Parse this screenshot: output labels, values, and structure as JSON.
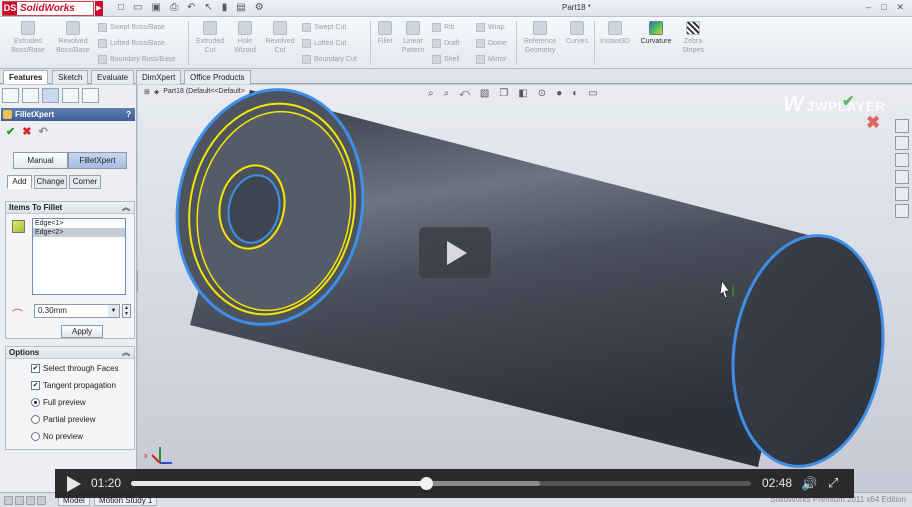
{
  "titlebar": {
    "app_name": "SolidWorks",
    "logo_letters": "DS",
    "document_title": "Part18 *",
    "window_controls": [
      "–",
      "□",
      "✕"
    ]
  },
  "ribbon": {
    "big_buttons": [
      {
        "icon": "extruded-boss-icon",
        "label1": "Extruded",
        "label2": "Boss/Base"
      },
      {
        "icon": "revolved-boss-icon",
        "label1": "Revolved",
        "label2": "Boss/Base"
      },
      {
        "icon": "extruded-cut-icon",
        "label1": "Extruded",
        "label2": "Cut"
      },
      {
        "icon": "hole-wizard-icon",
        "label1": "Hole",
        "label2": "Wizard"
      },
      {
        "icon": "revolved-cut-icon",
        "label1": "Revolved",
        "label2": "Cut"
      },
      {
        "icon": "fillet-icon",
        "label1": "Fillet",
        "label2": ""
      },
      {
        "icon": "linear-pattern-icon",
        "label1": "Linear",
        "label2": "Pattern"
      },
      {
        "icon": "reference-geometry-icon",
        "label1": "Reference",
        "label2": "Geometry"
      },
      {
        "icon": "curves-icon",
        "label1": "Curves",
        "label2": ""
      },
      {
        "icon": "instant3d-icon",
        "label1": "Instant3D",
        "label2": ""
      },
      {
        "icon": "curvature-icon",
        "label1": "Curvature",
        "label2": ""
      },
      {
        "icon": "zebra-stripes-icon",
        "label1": "Zebra",
        "label2": "Stripes"
      }
    ],
    "small_buttons": [
      {
        "icon": "swept-boss-icon",
        "label": "Swept Boss/Base"
      },
      {
        "icon": "lofted-boss-icon",
        "label": "Lofted Boss/Base"
      },
      {
        "icon": "boundary-boss-icon",
        "label": "Boundary Boss/Base"
      },
      {
        "icon": "swept-cut-icon",
        "label": "Swept Cut"
      },
      {
        "icon": "lofted-cut-icon",
        "label": "Lofted Cut"
      },
      {
        "icon": "boundary-cut-icon",
        "label": "Boundary Cut"
      },
      {
        "icon": "rib-icon",
        "label": "Rib"
      },
      {
        "icon": "draft-icon",
        "label": "Draft"
      },
      {
        "icon": "shell-icon",
        "label": "Shell"
      },
      {
        "icon": "wrap-icon",
        "label": "Wrap"
      },
      {
        "icon": "dome-icon",
        "label": "Dome"
      },
      {
        "icon": "mirror-icon",
        "label": "Mirror"
      }
    ]
  },
  "tabs": [
    "Features",
    "Sketch",
    "Evaluate",
    "DimXpert",
    "Office Products"
  ],
  "panel": {
    "title": "FilletXpert",
    "help": "?",
    "mode_buttons": [
      "Manual",
      "FilletXpert"
    ],
    "sub_tabs": [
      "Add",
      "Change",
      "Corner"
    ],
    "items_group": {
      "title": "Items To Fillet",
      "edges": [
        "Edge<1>",
        "Edge<2>"
      ]
    },
    "radius_value": "0.30mm",
    "apply_label": "Apply",
    "options_group": {
      "title": "Options",
      "checkboxes": [
        {
          "label": "Select through Faces",
          "checked": true
        },
        {
          "label": "Tangent propagation",
          "checked": true
        }
      ],
      "radios": [
        {
          "label": "Full preview",
          "selected": true
        },
        {
          "label": "Partial preview",
          "selected": false
        },
        {
          "label": "No preview",
          "selected": false
        }
      ]
    }
  },
  "viewport": {
    "tree_label": "Part18 (Default<<Default>",
    "watermark": "JWPLAYER",
    "triad_label": "x"
  },
  "bottom": {
    "tabs": [
      "Model",
      "Motion Study 1"
    ],
    "status": "SolidWorks Premium 2011 x64 Edition"
  },
  "video": {
    "current_time": "01:20",
    "total_time": "02:48",
    "progress_percent": 47.6,
    "buffer_percent": 66
  },
  "colors": {
    "solidworks_red": "#c8102e",
    "panel_header_blue": "#4a6ea5",
    "cylinder_fill": "#3d434e",
    "edge_highlight_blue": "#3f8fe8",
    "edge_highlight_yellow": "#f3e800"
  }
}
